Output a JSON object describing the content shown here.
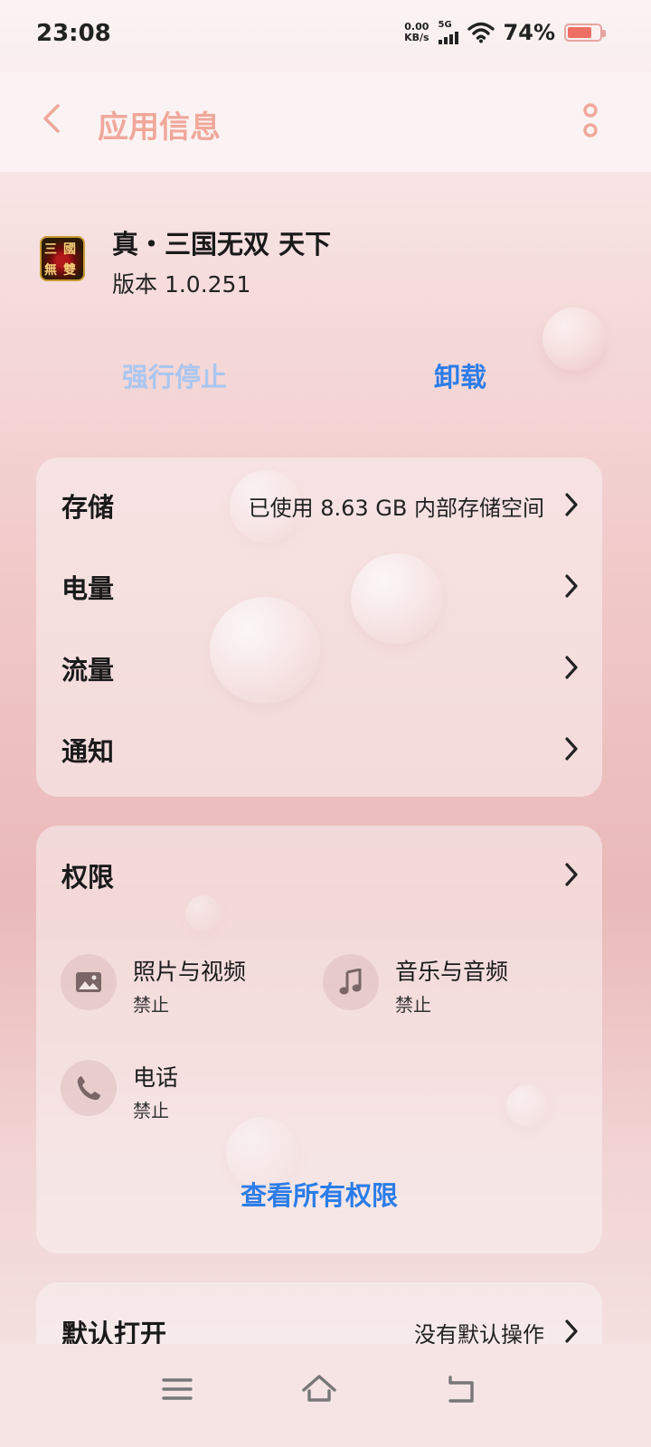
{
  "status_bar": {
    "time": "23:08",
    "net_speed_value": "0.00",
    "net_speed_unit": "KB/s",
    "network": "5G",
    "battery_percent": "74%",
    "battery_level": 0.74
  },
  "header": {
    "title": "应用信息",
    "back_icon": "chevron-left-icon",
    "more_icon": "more-vertical-icon"
  },
  "app": {
    "name": "真・三国无双 天下",
    "version": "版本 1.0.251",
    "icon_text": [
      "三",
      "國",
      "無",
      "雙"
    ]
  },
  "actions": {
    "force_stop": "强行停止",
    "uninstall": "卸载"
  },
  "settings": [
    {
      "label": "存储",
      "value": "已使用 8.63 GB 内部存储空间"
    },
    {
      "label": "电量",
      "value": ""
    },
    {
      "label": "流量",
      "value": ""
    },
    {
      "label": "通知",
      "value": ""
    }
  ],
  "permissions": {
    "title": "权限",
    "items": [
      {
        "name": "照片与视频",
        "status": "禁止",
        "icon": "image-icon"
      },
      {
        "name": "音乐与音频",
        "status": "禁止",
        "icon": "music-note-icon"
      },
      {
        "name": "电话",
        "status": "禁止",
        "icon": "phone-icon"
      }
    ],
    "view_all": "查看所有权限"
  },
  "default_open": {
    "label": "默认打开",
    "value": "没有默认操作"
  },
  "colors": {
    "accent_blue": "#2b7de9",
    "title_pink": "#f0a89b",
    "disabled_blue": "#a9c6f0"
  }
}
